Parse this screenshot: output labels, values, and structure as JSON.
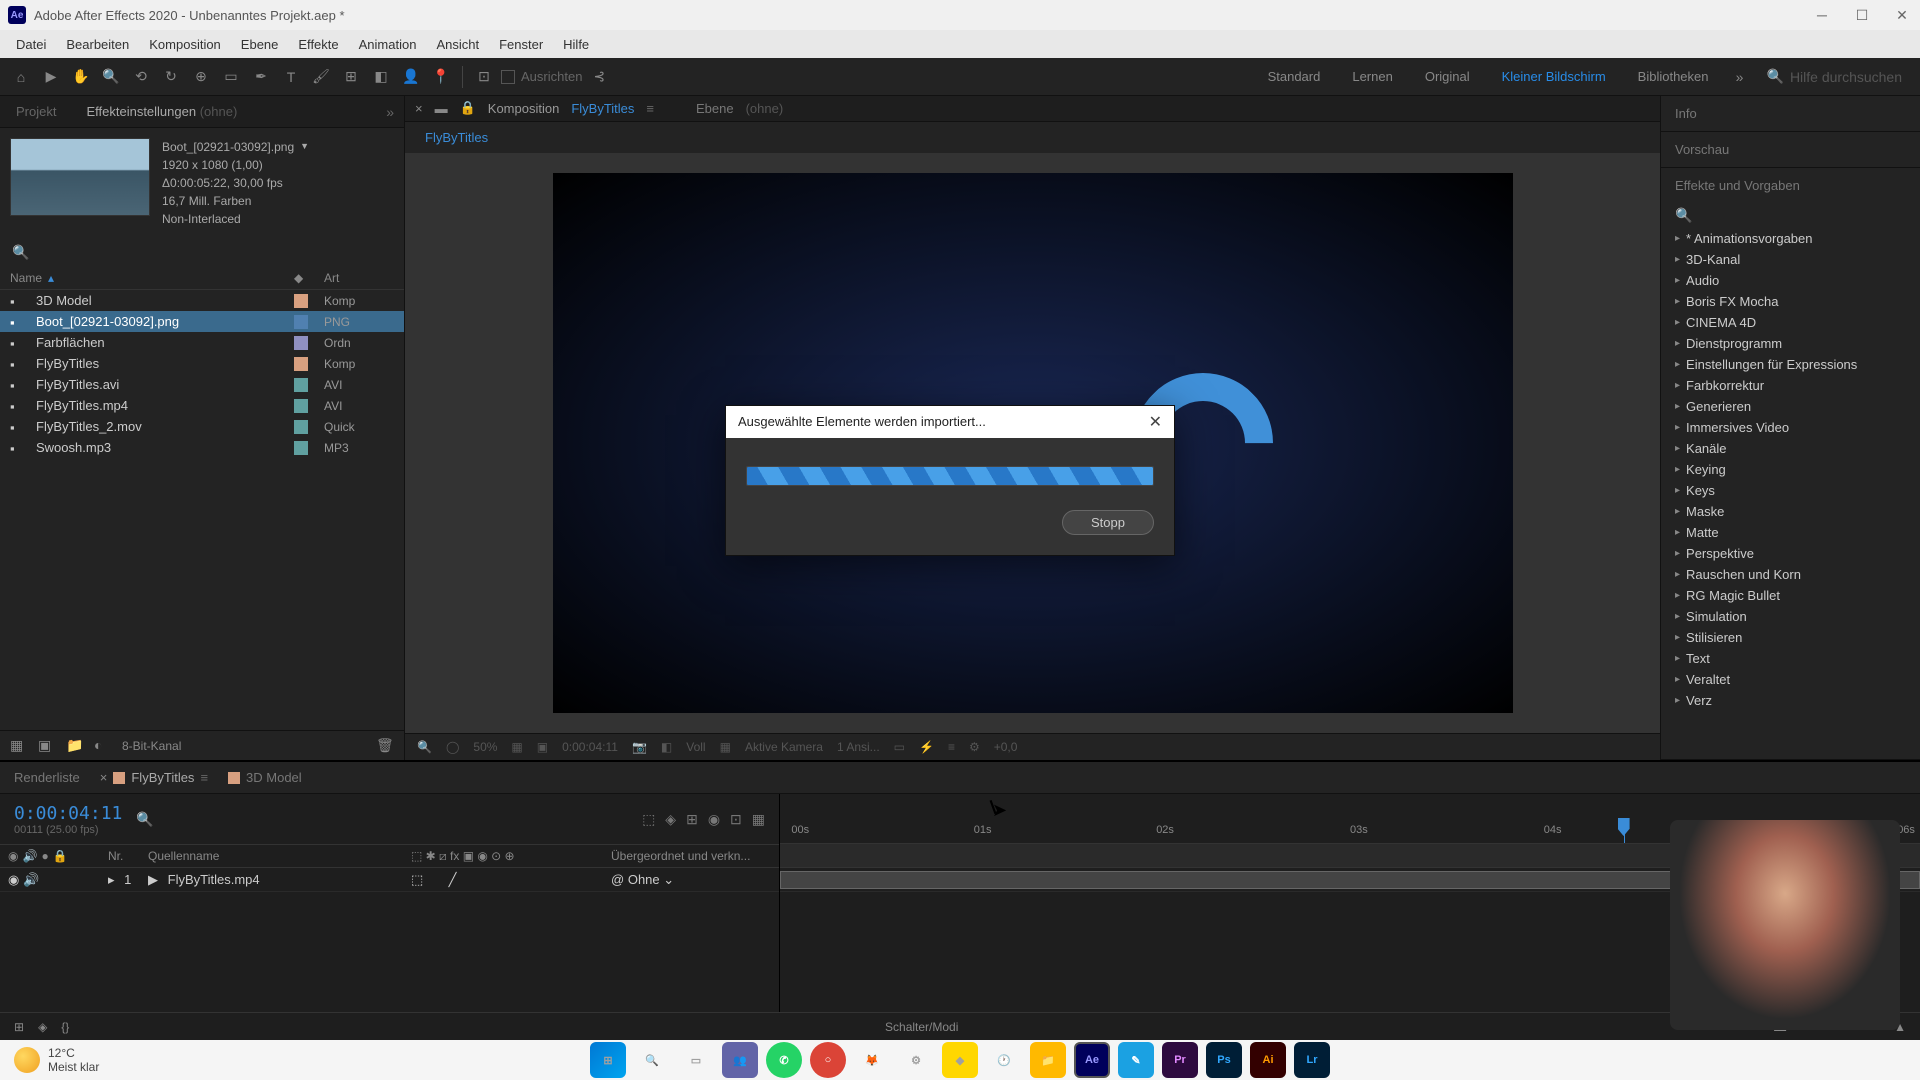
{
  "window": {
    "title": "Adobe After Effects 2020 - Unbenanntes Projekt.aep *"
  },
  "menu": [
    "Datei",
    "Bearbeiten",
    "Komposition",
    "Ebene",
    "Effekte",
    "Animation",
    "Ansicht",
    "Fenster",
    "Hilfe"
  ],
  "toolbar": {
    "align_label": "Ausrichten",
    "workspaces": [
      "Standard",
      "Lernen",
      "Original",
      "Kleiner Bildschirm",
      "Bibliotheken"
    ],
    "active_workspace": 3,
    "search_placeholder": "Hilfe durchsuchen"
  },
  "left": {
    "tabs": {
      "project": "Projekt",
      "effects": "Effekteinstellungen",
      "none": "(ohne)"
    },
    "asset": {
      "name": "Boot_[02921-03092].png",
      "res": "1920 x 1080 (1,00)",
      "dur": "Δ0:00:05:22, 30,00 fps",
      "colors": "16,7 Mill. Farben",
      "interlace": "Non-Interlaced"
    },
    "columns": {
      "name": "Name",
      "type": "Art"
    },
    "items": [
      {
        "name": "3D Model",
        "type": "Komp",
        "tag": "swatch-peach"
      },
      {
        "name": "Boot_[02921-03092].png",
        "type": "PNG",
        "tag": "swatch-blue",
        "selected": true
      },
      {
        "name": "Farbflächen",
        "type": "Ordn",
        "tag": "swatch-lav"
      },
      {
        "name": "FlyByTitles",
        "type": "Komp",
        "tag": "swatch-peach"
      },
      {
        "name": "FlyByTitles.avi",
        "type": "AVI",
        "tag": "swatch-teal"
      },
      {
        "name": "FlyByTitles.mp4",
        "type": "AVI",
        "tag": "swatch-teal"
      },
      {
        "name": "FlyByTitles_2.mov",
        "type": "Quick",
        "tag": "swatch-teal"
      },
      {
        "name": "Swoosh.mp3",
        "type": "MP3",
        "tag": "swatch-teal"
      }
    ],
    "footer": {
      "depth": "8-Bit-Kanal"
    }
  },
  "center": {
    "comp_label": "Komposition",
    "comp_name": "FlyByTitles",
    "ebene": "Ebene",
    "ebene_none": "(ohne)",
    "crumb": "FlyByTitles",
    "viewer_footer": {
      "zoom": "50%",
      "time": "0:00:04:11",
      "res": "Voll",
      "camera": "Aktive Kamera",
      "views": "1 Ansi...",
      "exposure": "+0,0"
    }
  },
  "right": {
    "info": "Info",
    "preview": "Vorschau",
    "effects_presets": "Effekte und Vorgaben",
    "effects": [
      "* Animationsvorgaben",
      "3D-Kanal",
      "Audio",
      "Boris FX Mocha",
      "CINEMA 4D",
      "Dienstprogramm",
      "Einstellungen für Expressions",
      "Farbkorrektur",
      "Generieren",
      "Immersives Video",
      "Kanäle",
      "Keying",
      "Keys",
      "Maske",
      "Matte",
      "Perspektive",
      "Rauschen und Korn",
      "RG Magic Bullet",
      "Simulation",
      "Stilisieren",
      "Text",
      "Veraltet",
      "Verz"
    ]
  },
  "timeline": {
    "tabs": {
      "render": "Renderliste",
      "comp": "FlyByTitles",
      "model": "3D Model"
    },
    "timecode": "0:00:04:11",
    "frame": "00111 (25.00 fps)",
    "header": {
      "nr": "Nr.",
      "name": "Quellenname",
      "parent": "Übergeordnet und verkn..."
    },
    "layer": {
      "nr": "1",
      "name": "FlyByTitles.mp4",
      "parent": "Ohne"
    },
    "ticks": [
      "00s",
      "01s",
      "02s",
      "03s",
      "04s",
      "06s"
    ],
    "footer_center": "Schalter/Modi"
  },
  "taskbar": {
    "temp": "12°C",
    "desc": "Meist klar"
  },
  "dialog": {
    "title": "Ausgewählte Elemente werden importiert...",
    "stop": "Stopp"
  }
}
